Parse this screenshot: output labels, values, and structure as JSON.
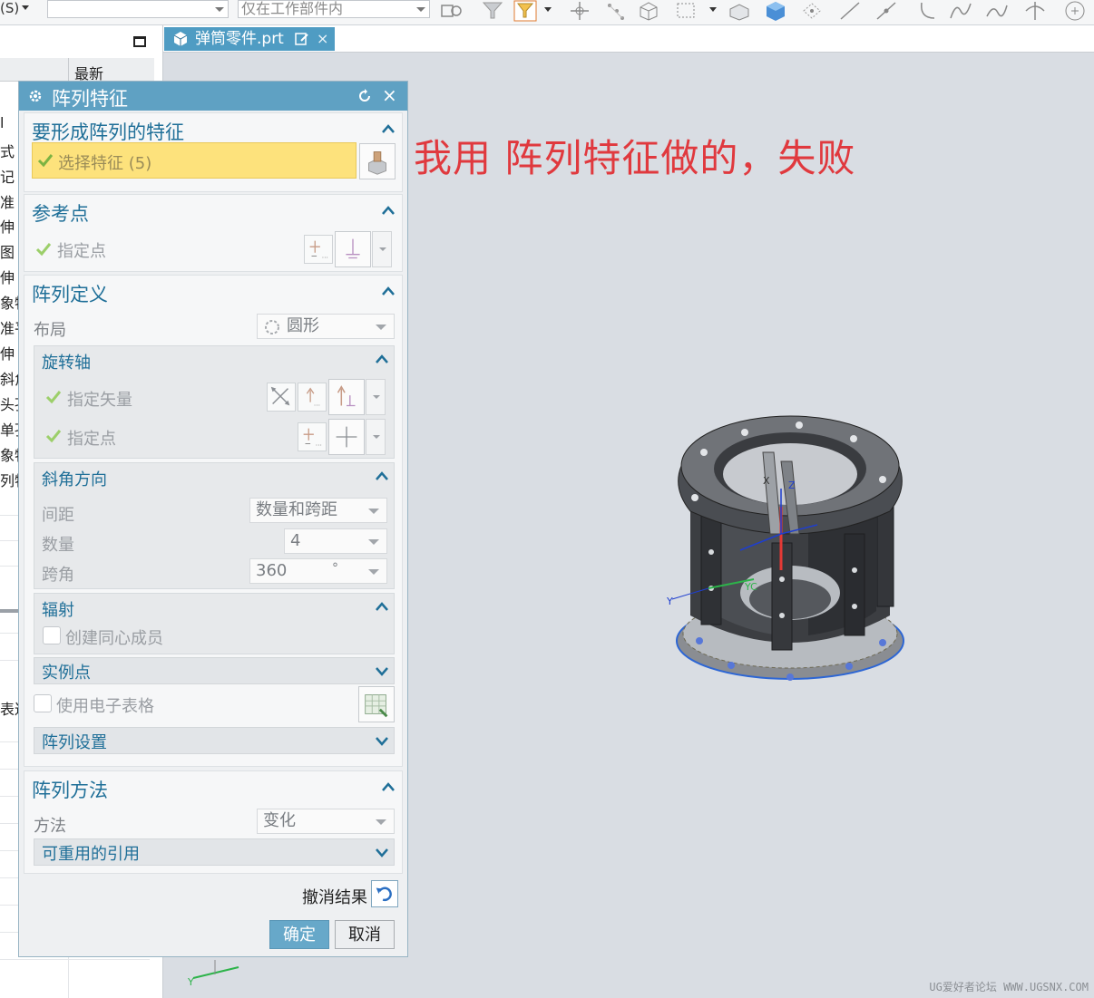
{
  "toolbar": {
    "selection_label": "(S)",
    "filter_placeholder": "",
    "scope_combo": "仅在工作部件内"
  },
  "navigator": {
    "recent_header": "最新",
    "row_fragments": [
      "l",
      "式",
      "记",
      "准",
      "伸（",
      "图（",
      "伸（",
      "象特",
      "准平",
      "伸（",
      "斜角",
      "头孔",
      "单孔",
      "象特",
      "列特",
      "表达"
    ]
  },
  "tab": {
    "part_name": "弹筒零件.prt",
    "close_glyph": "×"
  },
  "graphics": {
    "annotation": "我用 阵列特征做的，失败",
    "watermark": "UG爱好者论坛 WWW.UGSNX.COM",
    "triad_labels": {
      "x": "X",
      "y": "Y",
      "z": "Z",
      "yc": "YC",
      "corner_y": "Y"
    }
  },
  "dialog": {
    "title": "阵列特征",
    "close_glyph": "×",
    "features_section": {
      "title": "要形成阵列的特征",
      "select_label": "选择特征 (5)"
    },
    "reference_section": {
      "title": "参考点",
      "point_label": "指定点"
    },
    "definition_section": {
      "title": "阵列定义",
      "layout_label": "布局",
      "layout_value": "圆形",
      "rotation_axis": {
        "title": "旋转轴",
        "vector_label": "指定矢量",
        "point_label": "指定点"
      },
      "angular_direction": {
        "title": "斜角方向",
        "spacing_label": "间距",
        "spacing_value": "数量和跨距",
        "count_label": "数量",
        "count_value": "4",
        "span_label": "跨角",
        "span_value": "360",
        "span_unit": "°"
      },
      "radiate": {
        "title": "辐射",
        "concentric_label": "创建同心成员"
      },
      "instance_points_title": "实例点",
      "spreadsheet_label": "使用电子表格",
      "settings_title": "阵列设置"
    },
    "method_section": {
      "title": "阵列方法",
      "method_label": "方法",
      "method_value": "变化",
      "reusable_title": "可重用的引用"
    },
    "undo_label": "撤消结果",
    "ok_label": "确定",
    "cancel_label": "取消"
  },
  "colors": {
    "title_bar": "#5fa1c3",
    "section_title": "#1f6f98",
    "selection_highlight": "#fde27c",
    "annotation_red": "#e0393e",
    "check_green": "#7cb342"
  }
}
